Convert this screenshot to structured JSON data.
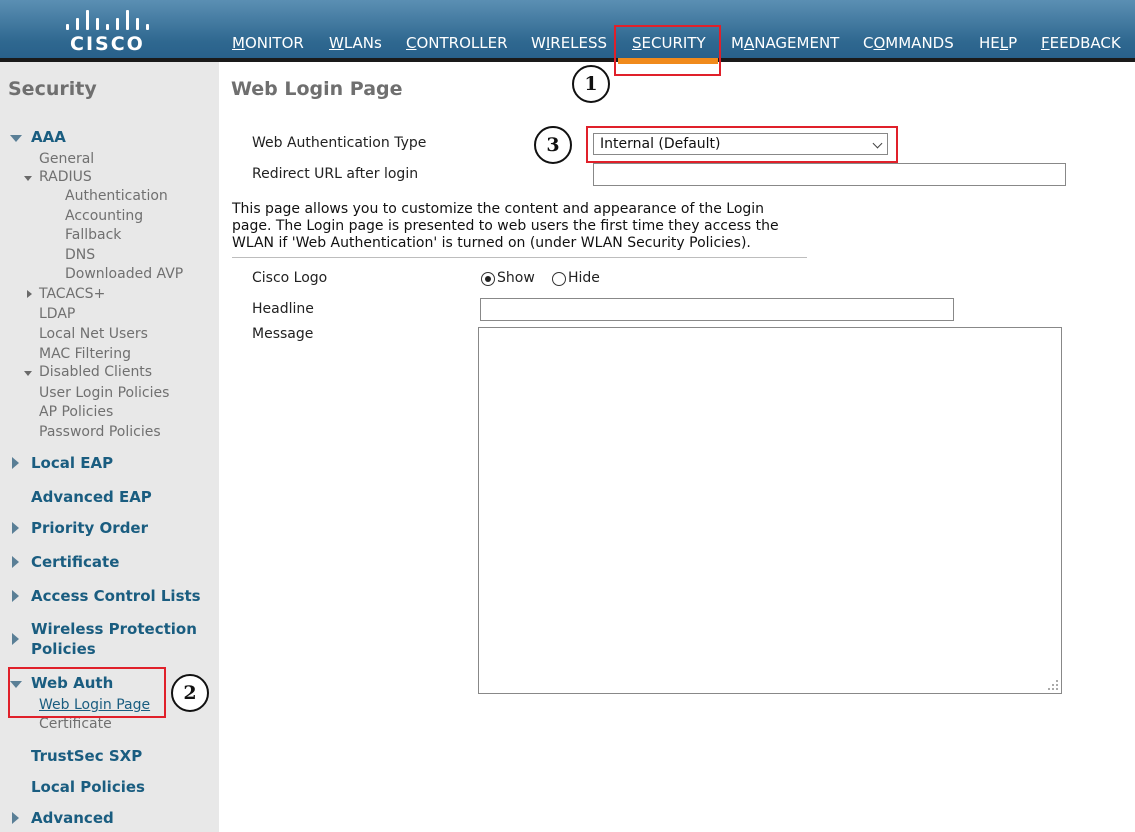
{
  "header": {
    "logo_text": "CISCO",
    "nav": [
      {
        "label": "MONITOR",
        "key": "M",
        "rest": "ONITOR"
      },
      {
        "label": "WLANs",
        "key": "W",
        "rest": "LANs"
      },
      {
        "label": "CONTROLLER",
        "key": "C",
        "rest": "ONTROLLER"
      },
      {
        "label": "WIRELESS",
        "pre": "W",
        "key": "I",
        "rest": "RELESS"
      },
      {
        "label": "SECURITY",
        "key": "S",
        "rest": "ECURITY"
      },
      {
        "label": "MANAGEMENT",
        "pre": "M",
        "key": "A",
        "rest": "NAGEMENT"
      },
      {
        "label": "COMMANDS",
        "pre": "C",
        "key": "O",
        "rest": "MMANDS"
      },
      {
        "label": "HELP",
        "pre": "HE",
        "key": "L",
        "rest": "P"
      },
      {
        "label": "FEEDBACK",
        "key": "F",
        "rest": "EEDBACK"
      }
    ],
    "active_color": "#f08a1c"
  },
  "sidebar": {
    "title": "Security",
    "aaa": {
      "label": "AAA",
      "general": "General",
      "radius": "RADIUS",
      "radius_items": [
        "Authentication",
        "Accounting",
        "Fallback",
        "DNS",
        "Downloaded AVP"
      ],
      "tacacs": "TACACS+",
      "ldap": "LDAP",
      "local_net_users": "Local Net Users",
      "mac_filtering": "MAC Filtering",
      "disabled_clients": "Disabled Clients",
      "user_login_policies": "User Login Policies",
      "ap_policies": "AP Policies",
      "password_policies": "Password Policies"
    },
    "local_eap": "Local EAP",
    "advanced_eap": "Advanced EAP",
    "priority_order": "Priority Order",
    "certificate": "Certificate",
    "acl": "Access Control Lists",
    "wpp_line1": "Wireless Protection",
    "wpp_line2": "Policies",
    "web_auth": "Web Auth",
    "web_login_page": "Web Login Page",
    "web_auth_certificate": "Certificate",
    "trustsec": "TrustSec SXP",
    "local_policies": "Local Policies",
    "advanced": "Advanced"
  },
  "main": {
    "title": "Web Login Page",
    "web_auth_type_label": "Web Authentication Type",
    "web_auth_type_value": "Internal (Default)",
    "redirect_label": "Redirect URL after login",
    "redirect_value": "",
    "description": "This page allows you to customize the content and appearance of the Login page. The Login page is presented to web users the first time they access the WLAN if 'Web Authentication' is turned on (under WLAN Security Policies).",
    "cisco_logo_label": "Cisco Logo",
    "show_label": "Show",
    "hide_label": "Hide",
    "cisco_logo_selected": "Show",
    "headline_label": "Headline",
    "headline_value": "",
    "message_label": "Message",
    "message_value": ""
  },
  "annotations": {
    "marker1": "1",
    "marker2": "2",
    "marker3": "3",
    "highlight_color": "#e0202a"
  }
}
